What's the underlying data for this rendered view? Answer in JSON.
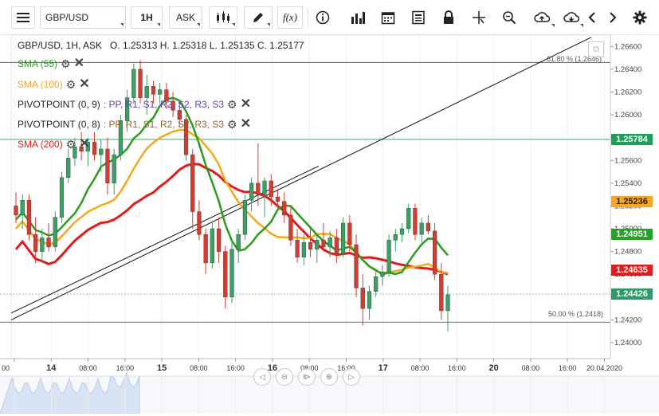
{
  "toolbar": {
    "symbol": "GBP/USD",
    "interval": "1H",
    "price_side": "ASK",
    "fx_label": "f(x)",
    "icons": [
      "menu-icon",
      "candles-icon",
      "pencil-icon",
      "fx-icon",
      "info-icon",
      "bars-icon",
      "calendar-icon",
      "news-icon",
      "lock-icon",
      "crosshair-icon",
      "zoom-icon",
      "upload-icon",
      "download-icon",
      "chevron-left-icon",
      "chevron-right-icon",
      "gear-icon"
    ]
  },
  "ohlc": {
    "text": "GBP/USD, 1H, ASK   O. 1.25313 H. 1.25318 L. 1.25135 C. 1.25177"
  },
  "legend": {
    "sma55": "SMA (55)",
    "sma100": "SMA (100)",
    "pivot1_label": "PIVOTPOINT (0, 9)",
    "pivot1_items": ": PP, R1, S1, R2, S2, R3, S3",
    "pivot2_label": "PIVOTPOINT (0, 8)",
    "pivot2_items": ": PP, R1, S1, R2, S2, R3, S3",
    "sma200": "SMA (200)"
  },
  "fib": {
    "upper": "61.80 % (1.2646)",
    "lower": "50.00 % (1.2418)"
  },
  "price_axis": {
    "ticks": [
      "1.26600",
      "1.26400",
      "1.26200",
      "1.26000",
      "1.25800",
      "1.25600",
      "1.25400",
      "1.25200",
      "1.25000",
      "1.24800",
      "1.24600",
      "1.24400",
      "1.24200",
      "1.24000"
    ],
    "tags": [
      {
        "label": "1.25784",
        "bg": "#1e9e5a",
        "fg": "#ffffff",
        "price": 1.25784
      },
      {
        "label": "1.25236",
        "bg": "#f5a623",
        "fg": "#222222",
        "price": 1.25236
      },
      {
        "label": "1.24951",
        "bg": "#22a422",
        "fg": "#ffffff",
        "price": 1.24951
      },
      {
        "label": "1.24635",
        "bg": "#e31b1b",
        "fg": "#ffffff",
        "price": 1.24635
      },
      {
        "label": "1.24426",
        "bg": "#2e9a6a",
        "fg": "#ffffff",
        "price": 1.24426
      }
    ]
  },
  "time_axis": {
    "labels": [
      "00",
      "14",
      "08:00",
      "16:00",
      "15",
      "08:00",
      "16:00",
      "16",
      "08:00",
      "16:00",
      "17",
      "08:00",
      "16:00",
      "20",
      "08:00",
      "16:00",
      "20.04.2020"
    ],
    "bold": [
      false,
      true,
      false,
      false,
      true,
      false,
      false,
      true,
      false,
      false,
      true,
      false,
      false,
      true,
      false,
      false,
      false
    ]
  },
  "colors": {
    "up": "#3aa063",
    "down": "#d63b2f",
    "sma55": "#2a9d1e",
    "sma100": "#f5a81c",
    "sma200": "#e31b1b",
    "pivot_pp": "#b23cb2",
    "pivot_r": "#2aa02a",
    "pivot_s": "#2a6bd6",
    "pivot_r_brown": "#8a6a2a"
  },
  "chart_data": {
    "type": "candlestick",
    "title": "GBP/USD, 1H, ASK",
    "ylim": [
      1.2386,
      1.267
    ],
    "candles": [
      [
        1.252,
        1.2532,
        1.2505,
        1.2512
      ],
      [
        1.2512,
        1.253,
        1.25,
        1.2525
      ],
      [
        1.2525,
        1.253,
        1.249,
        1.2495
      ],
      [
        1.2495,
        1.251,
        1.247,
        1.248
      ],
      [
        1.248,
        1.25,
        1.247,
        1.2492
      ],
      [
        1.2492,
        1.2505,
        1.248,
        1.2484
      ],
      [
        1.2484,
        1.2515,
        1.248,
        1.251
      ],
      [
        1.251,
        1.255,
        1.2505,
        1.2545
      ],
      [
        1.2545,
        1.257,
        1.254,
        1.2562
      ],
      [
        1.2562,
        1.258,
        1.2555,
        1.2572
      ],
      [
        1.2572,
        1.2585,
        1.256,
        1.2568
      ],
      [
        1.2568,
        1.258,
        1.2555,
        1.2576
      ],
      [
        1.2576,
        1.2585,
        1.256,
        1.2565
      ],
      [
        1.2565,
        1.2578,
        1.255,
        1.257
      ],
      [
        1.257,
        1.258,
        1.253,
        1.254
      ],
      [
        1.254,
        1.257,
        1.253,
        1.2565
      ],
      [
        1.2565,
        1.26,
        1.256,
        1.2595
      ],
      [
        1.2595,
        1.2622,
        1.2585,
        1.2615
      ],
      [
        1.2615,
        1.2645,
        1.261,
        1.264
      ],
      [
        1.264,
        1.2648,
        1.261,
        1.2615
      ],
      [
        1.2615,
        1.2635,
        1.26,
        1.2625
      ],
      [
        1.2625,
        1.263,
        1.261,
        1.2618
      ],
      [
        1.2618,
        1.2628,
        1.261,
        1.2622
      ],
      [
        1.2622,
        1.2628,
        1.2605,
        1.2612
      ],
      [
        1.2612,
        1.262,
        1.2598,
        1.2604
      ],
      [
        1.2604,
        1.2612,
        1.259,
        1.2596
      ],
      [
        1.2596,
        1.26,
        1.256,
        1.2565
      ],
      [
        1.2565,
        1.257,
        1.25,
        1.2515
      ],
      [
        1.2515,
        1.2525,
        1.249,
        1.2495
      ],
      [
        1.2495,
        1.25,
        1.246,
        1.247
      ],
      [
        1.247,
        1.2505,
        1.2465,
        1.25
      ],
      [
        1.25,
        1.251,
        1.247,
        1.248
      ],
      [
        1.248,
        1.2485,
        1.243,
        1.244
      ],
      [
        1.244,
        1.249,
        1.2435,
        1.2482
      ],
      [
        1.2482,
        1.25,
        1.247,
        1.2495
      ],
      [
        1.2495,
        1.253,
        1.249,
        1.2525
      ],
      [
        1.2525,
        1.2545,
        1.2515,
        1.254
      ],
      [
        1.254,
        1.2575,
        1.252,
        1.253
      ],
      [
        1.253,
        1.2545,
        1.251,
        1.2542
      ],
      [
        1.2542,
        1.2548,
        1.252,
        1.2528
      ],
      [
        1.2528,
        1.2535,
        1.2518,
        1.2524
      ],
      [
        1.2524,
        1.2532,
        1.2505,
        1.2512
      ],
      [
        1.2512,
        1.252,
        1.2485,
        1.249
      ],
      [
        1.249,
        1.25,
        1.247,
        1.2475
      ],
      [
        1.2475,
        1.2495,
        1.2468,
        1.2488
      ],
      [
        1.2488,
        1.25,
        1.2475,
        1.2482
      ],
      [
        1.2482,
        1.2495,
        1.247,
        1.249
      ],
      [
        1.249,
        1.2505,
        1.248,
        1.2484
      ],
      [
        1.2484,
        1.2498,
        1.2475,
        1.2492
      ],
      [
        1.2492,
        1.25,
        1.247,
        1.2478
      ],
      [
        1.2478,
        1.251,
        1.2475,
        1.2505
      ],
      [
        1.2505,
        1.2512,
        1.248,
        1.2486
      ],
      [
        1.2486,
        1.2495,
        1.244,
        1.2448
      ],
      [
        1.2448,
        1.246,
        1.2415,
        1.243
      ],
      [
        1.243,
        1.245,
        1.242,
        1.2445
      ],
      [
        1.2445,
        1.2462,
        1.244,
        1.2458
      ],
      [
        1.2458,
        1.2468,
        1.245,
        1.2462
      ],
      [
        1.2462,
        1.2495,
        1.2458,
        1.249
      ],
      [
        1.249,
        1.25,
        1.248,
        1.2495
      ],
      [
        1.2495,
        1.2505,
        1.2488,
        1.25
      ],
      [
        1.25,
        1.2522,
        1.2496,
        1.2518
      ],
      [
        1.2518,
        1.2522,
        1.249,
        1.2495
      ],
      [
        1.2495,
        1.251,
        1.2488,
        1.2505
      ],
      [
        1.2505,
        1.2512,
        1.2495,
        1.2498
      ],
      [
        1.2498,
        1.2505,
        1.2455,
        1.246
      ],
      [
        1.246,
        1.247,
        1.242,
        1.2428
      ],
      [
        1.2428,
        1.245,
        1.241,
        1.2442
      ]
    ]
  }
}
